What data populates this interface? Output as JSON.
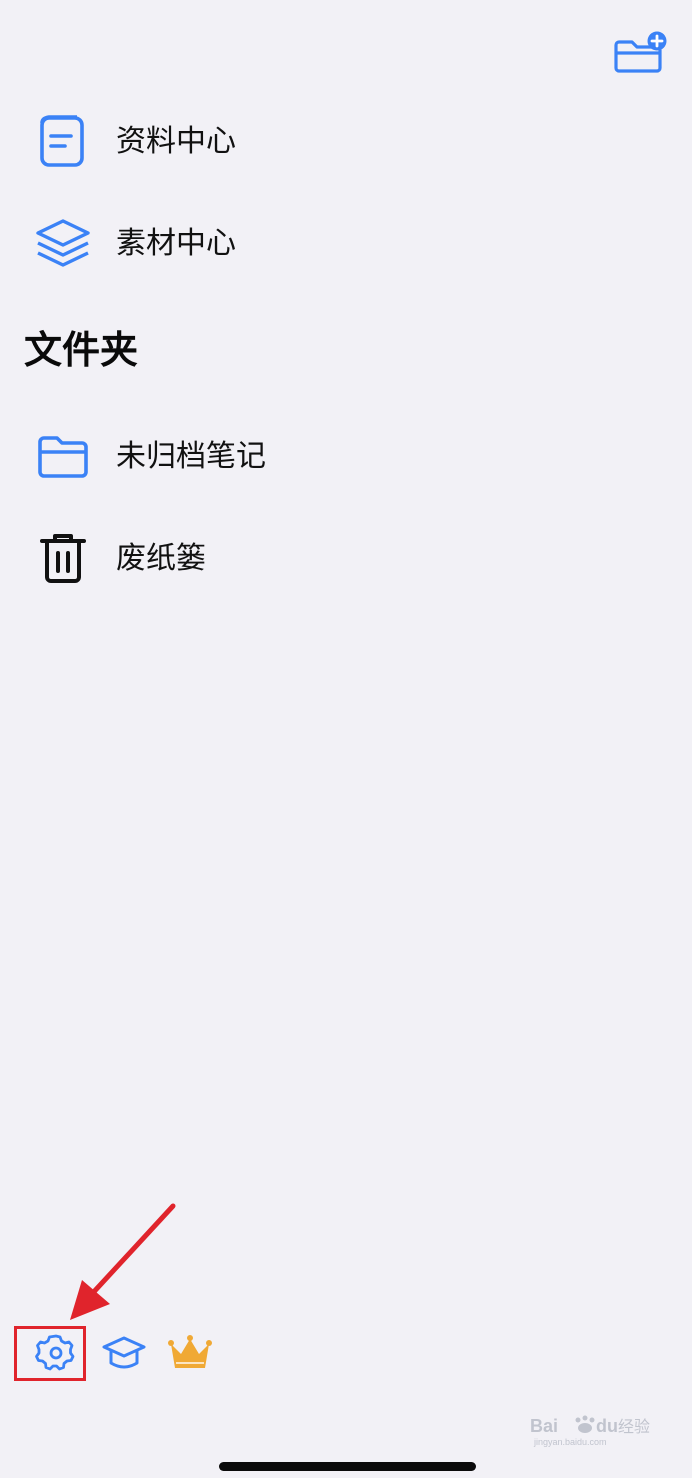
{
  "header": {
    "new_folder_icon": "folder-plus-icon"
  },
  "library": {
    "items": [
      {
        "label": "资料中心",
        "icon": "notebook-icon"
      },
      {
        "label": "素材中心",
        "icon": "layers-icon"
      }
    ]
  },
  "folders": {
    "title": "文件夹",
    "items": [
      {
        "label": "未归档笔记",
        "icon": "folder-icon"
      },
      {
        "label": "废纸篓",
        "icon": "trash-icon"
      }
    ]
  },
  "bottom_bar": {
    "buttons": [
      {
        "icon": "gear-icon"
      },
      {
        "icon": "graduation-cap-icon"
      },
      {
        "icon": "crown-icon"
      }
    ]
  },
  "watermark": {
    "text": "Baidu经验",
    "subtext": "jingyan.baidu.com"
  },
  "colors": {
    "background": "#f2f1f6",
    "accent": "#3b82f6",
    "text": "#111111",
    "crown": "#f0a935",
    "annotation": "#e0242c"
  }
}
